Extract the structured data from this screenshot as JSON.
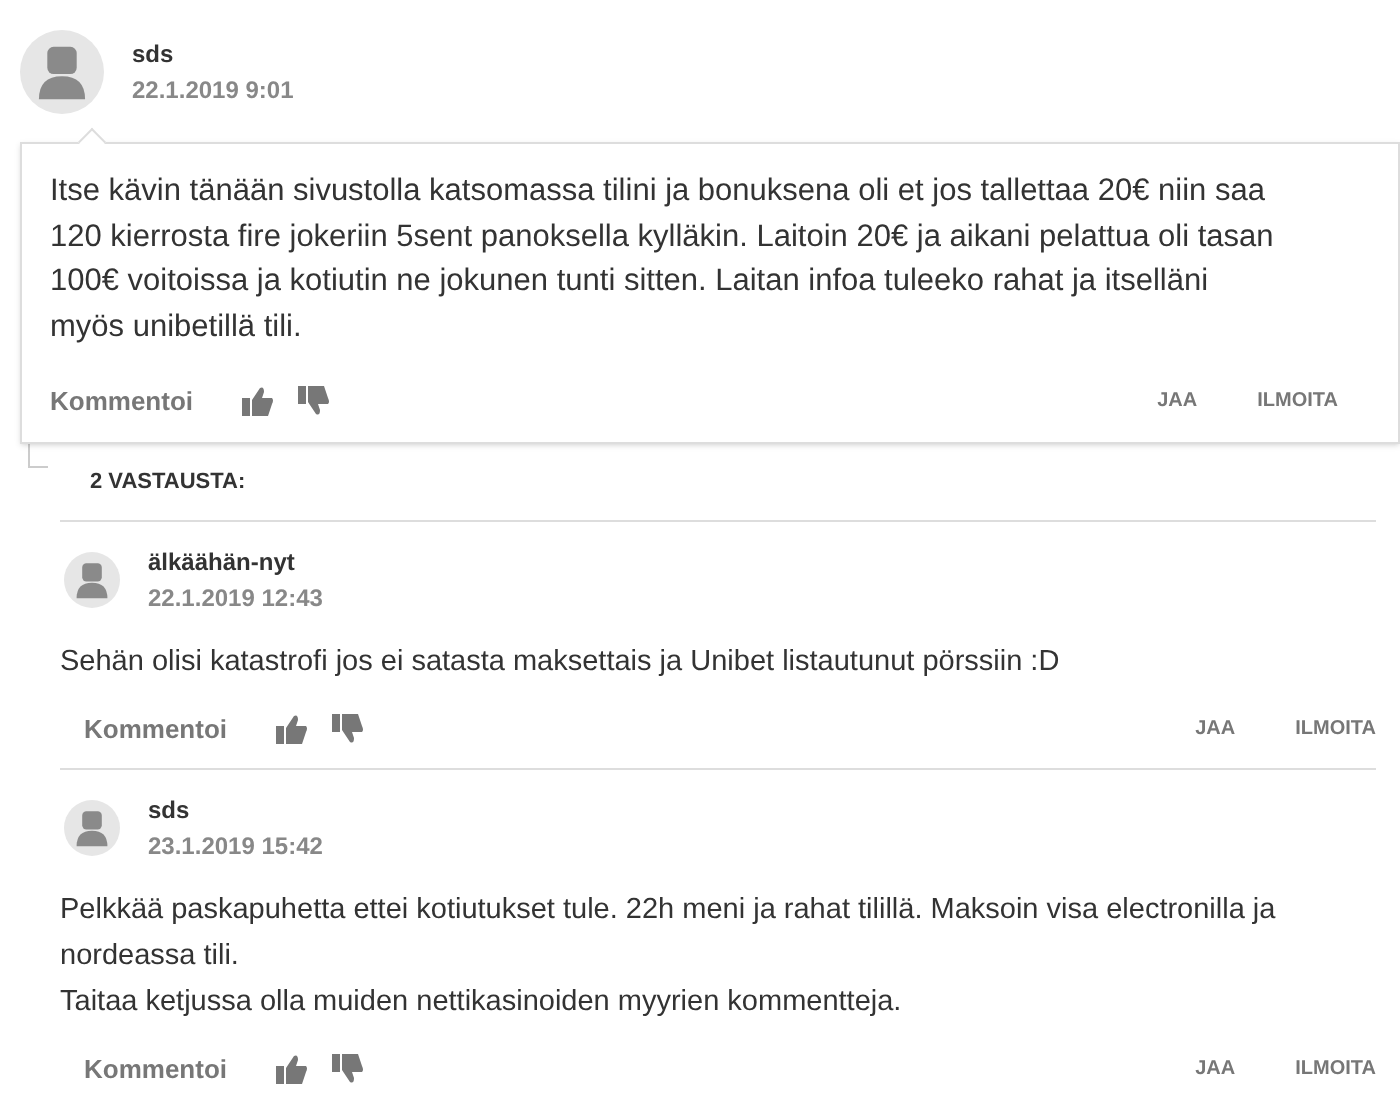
{
  "comment": {
    "author": "sds",
    "date": "22.1.2019 9:01",
    "text": "Itse kävin tänään sivustolla katsomassa tilini ja bonuksena oli et jos tallettaa 20€ niin saa 120 kierrosta fire jokeriin 5sent panoksella kylläkin. Laitoin 20€ ja aikani pelattua oli tasan 100€ voitoissa ja kotiutin ne jokunen tunti sitten. Laitan infoa tuleeko rahat ja itselläni myös unibetillä tili.",
    "actions": {
      "comment": "Kommentoi",
      "share": "JAA",
      "report": "ILMOITA"
    }
  },
  "replies_heading": "2 VASTAUSTA:",
  "replies": [
    {
      "author": "älkäähän-nyt",
      "date": "22.1.2019 12:43",
      "text": "Sehän olisi katastrofi jos ei satasta maksettais ja Unibet listautunut pörssiin :D",
      "actions": {
        "comment": "Kommentoi",
        "share": "JAA",
        "report": "ILMOITA"
      }
    },
    {
      "author": "sds",
      "date": "23.1.2019 15:42",
      "text": "Pelkkää paskapuhetta ettei kotiutukset tule. 22h meni ja rahat tilillä. Maksoin visa electronilla ja nordeassa tili.\nTaitaa ketjussa olla muiden nettikasinoiden myyrien kommentteja.",
      "actions": {
        "comment": "Kommentoi",
        "share": "JAA",
        "report": "ILMOITA"
      }
    }
  ]
}
